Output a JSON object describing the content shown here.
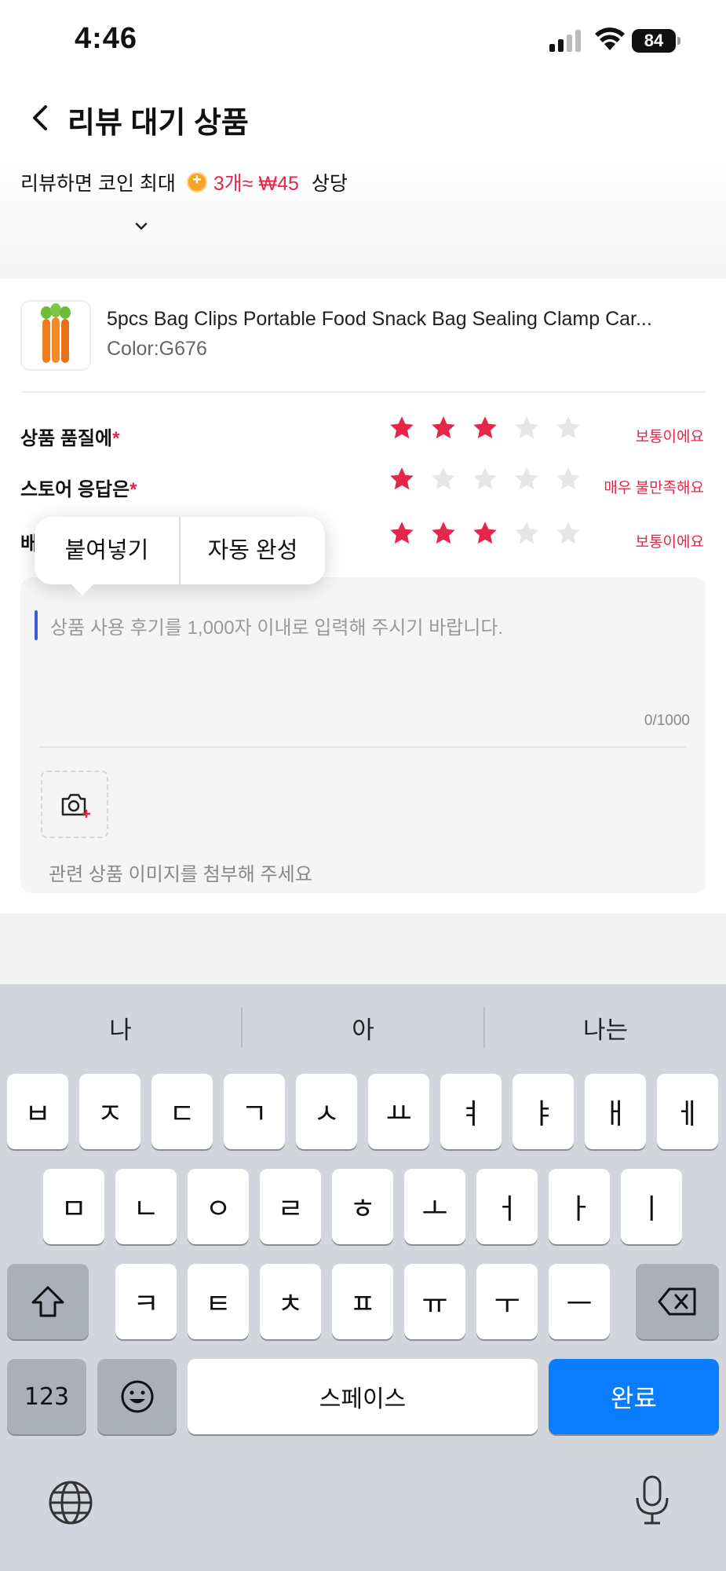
{
  "status_bar": {
    "time": "4:46",
    "battery": "84"
  },
  "header": {
    "title": "리뷰 대기 상품"
  },
  "promo": {
    "prefix": "리뷰하면 코인 최대",
    "reward": "3개≈ ₩45",
    "suffix": "상당"
  },
  "product": {
    "title": "5pcs Bag Clips Portable Food Snack Bag Sealing Clamp Car...",
    "color": "Color:G676"
  },
  "ratings": [
    {
      "label": "상품 품질에",
      "required": "*",
      "stars": 3,
      "text": "보통이에요"
    },
    {
      "label": "스토어 응답은",
      "required": "*",
      "stars": 1,
      "text": "매우 불만족해요"
    },
    {
      "label": "배",
      "required": "",
      "stars": 3,
      "text": "보통이에요"
    }
  ],
  "popup": {
    "paste": "붙여넣기",
    "autofill": "자동 완성"
  },
  "review": {
    "placeholder": "상품 사용 후기를 1,000자 이내로 입력해 주시기 바랍니다.",
    "counter": "0/1000",
    "attach_hint": "관련 상품 이미지를 첨부해 주세요"
  },
  "keyboard": {
    "suggestions": [
      "나",
      "아",
      "나는"
    ],
    "row1": [
      "ㅂ",
      "ㅈ",
      "ㄷ",
      "ㄱ",
      "ㅅ",
      "ㅛ",
      "ㅕ",
      "ㅑ",
      "ㅐ",
      "ㅔ"
    ],
    "row2": [
      "ㅁ",
      "ㄴ",
      "ㅇ",
      "ㄹ",
      "ㅎ",
      "ㅗ",
      "ㅓ",
      "ㅏ",
      "ㅣ"
    ],
    "row3": [
      "ㅋ",
      "ㅌ",
      "ㅊ",
      "ㅍ",
      "ㅠ",
      "ㅜ",
      "ㅡ"
    ],
    "numbers": "123",
    "space": "스페이스",
    "done": "완료"
  },
  "colors": {
    "accent_red": "#e5264a",
    "star_empty": "#e6e6e6",
    "keyboard_blue": "#0a7cff",
    "caret": "#3b5bdb"
  }
}
